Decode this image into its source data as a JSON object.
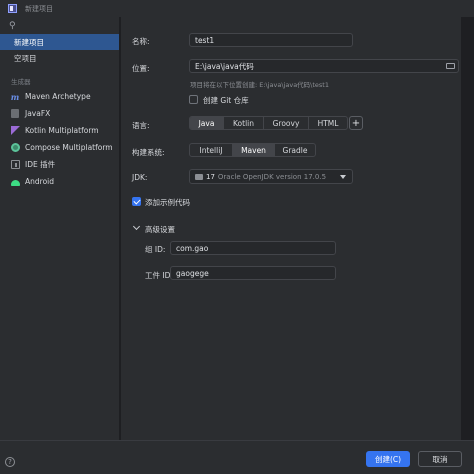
{
  "window": {
    "title": "新建项目"
  },
  "sidebar": {
    "search_icon": "search-icon",
    "items": [
      {
        "label": "新建项目",
        "selected": true
      },
      {
        "label": "空项目",
        "selected": false
      }
    ],
    "generators_header": "生成器",
    "generators": [
      {
        "label": "Maven Archetype",
        "icon": "maven-icon"
      },
      {
        "label": "JavaFX",
        "icon": "javafx-icon"
      },
      {
        "label": "Kotlin Multiplatform",
        "icon": "kotlin-icon"
      },
      {
        "label": "Compose Multiplatform",
        "icon": "compose-icon"
      },
      {
        "label": "IDE 插件",
        "icon": "ide-plugin-icon"
      },
      {
        "label": "Android",
        "icon": "android-icon"
      }
    ]
  },
  "form": {
    "name_label": "名称:",
    "name_value": "test1",
    "location_label": "位置:",
    "location_value": "E:\\java\\java代码",
    "location_hint": "项目将在以下位置创建: E:\\java\\java代码\\test1",
    "git_label": "创建 Git 仓库",
    "git_checked": false,
    "language_label": "语言:",
    "languages": [
      "Java",
      "Kotlin",
      "Groovy",
      "HTML"
    ],
    "language_selected": "Java",
    "add_language": "+",
    "build_label": "构建系统:",
    "build_systems": [
      "IntelliJ",
      "Maven",
      "Gradle"
    ],
    "build_selected": "Maven",
    "jdk_label": "JDK:",
    "jdk_version": "17",
    "jdk_name": "Oracle OpenJDK version 17.0.5",
    "sample_label": "添加示例代码",
    "sample_checked": true,
    "advanced_label": "高级设置",
    "group_label": "组 ID:",
    "group_value": "com.gao",
    "artifact_label": "工件 ID:",
    "artifact_value": "gaogege"
  },
  "footer": {
    "help": "?",
    "create_label": "创建(C)",
    "cancel_label": "取消"
  },
  "colors": {
    "accent": "#3574f0",
    "selected_bg": "#2e5791",
    "panel_bg": "#2b2d30"
  }
}
